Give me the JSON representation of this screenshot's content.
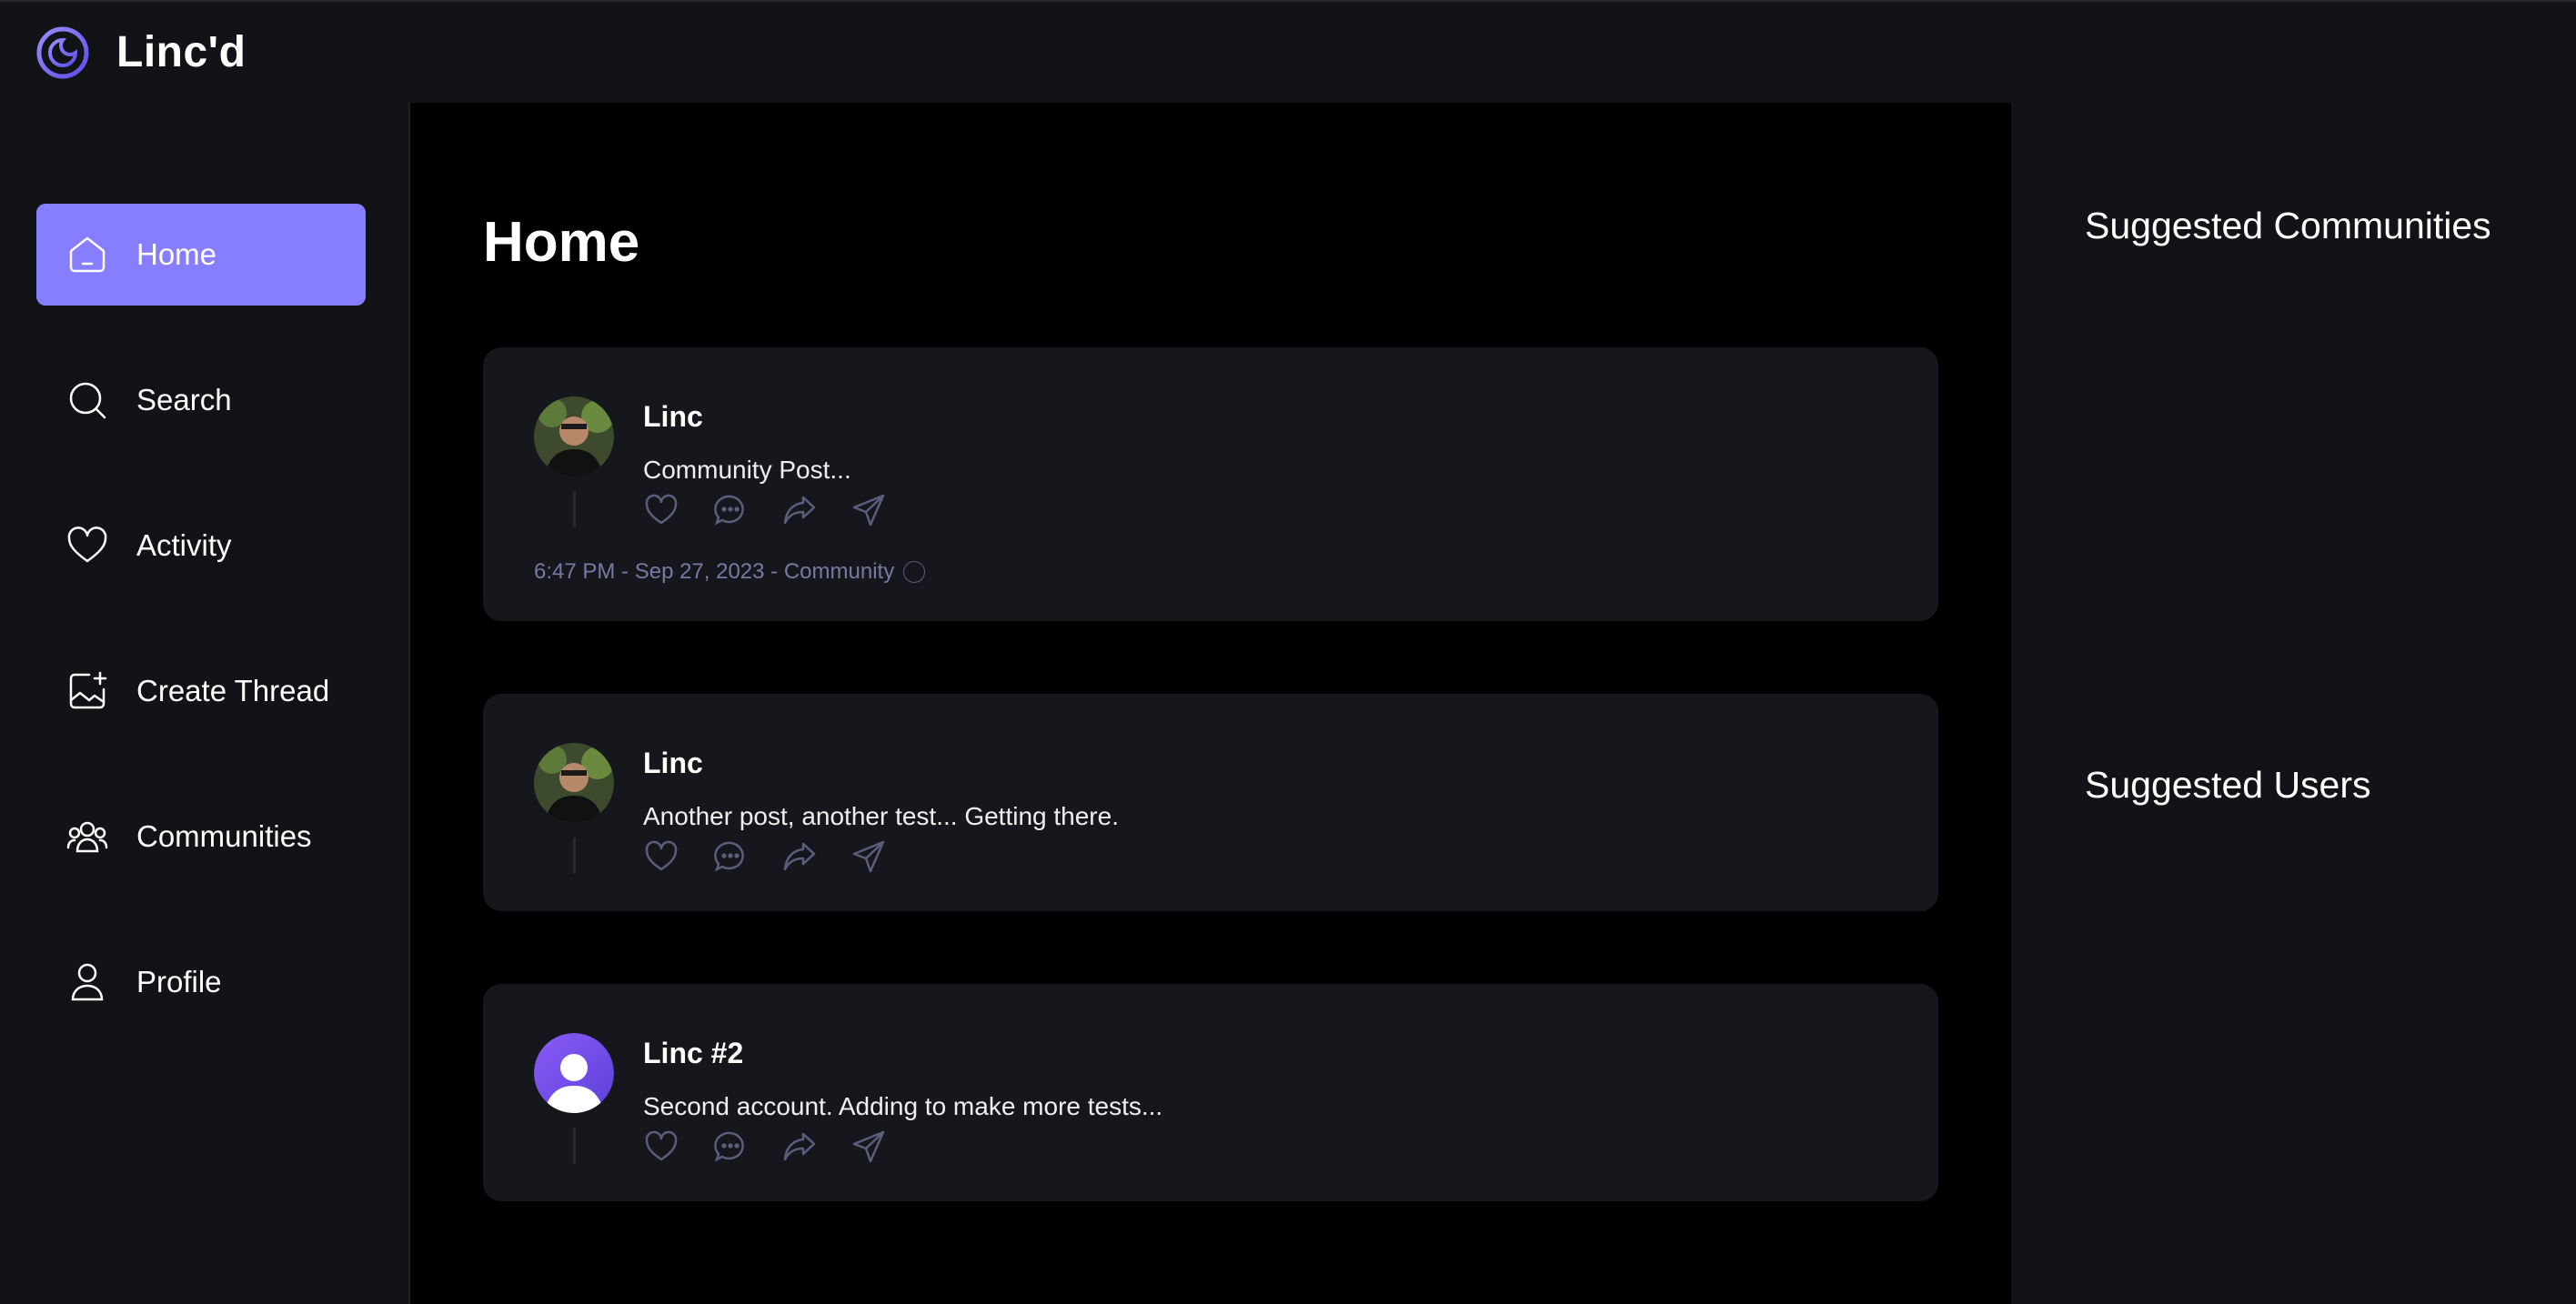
{
  "brand": {
    "name": "Linc'd"
  },
  "sidebar": {
    "items": [
      {
        "label": "Home",
        "icon": "home-icon",
        "active": true
      },
      {
        "label": "Search",
        "icon": "search-icon",
        "active": false
      },
      {
        "label": "Activity",
        "icon": "heart-icon",
        "active": false
      },
      {
        "label": "Create Thread",
        "icon": "image-plus-icon",
        "active": false
      },
      {
        "label": "Communities",
        "icon": "users-icon",
        "active": false
      },
      {
        "label": "Profile",
        "icon": "user-icon",
        "active": false
      }
    ]
  },
  "main": {
    "title": "Home",
    "posts": [
      {
        "author": "Linc",
        "text": "Community Post...",
        "meta": "6:47 PM - Sep 27, 2023 - Community"
      },
      {
        "author": "Linc",
        "text": "Another post, another test... Getting there."
      },
      {
        "author": "Linc #2",
        "text": "Second account. Adding to make more tests..."
      }
    ]
  },
  "rightbar": {
    "communities_title": "Suggested Communities",
    "users_title": "Suggested Users"
  },
  "colors": {
    "accent": "#877eff",
    "background": "#121317",
    "card": "#16171c",
    "muted": "#7878a3"
  }
}
